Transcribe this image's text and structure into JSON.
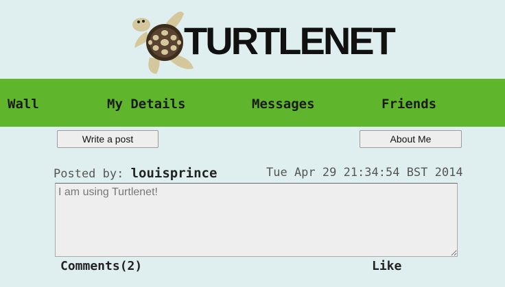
{
  "header": {
    "logo_text": "TURTLENET",
    "logo_icon": "turtle-icon"
  },
  "nav": {
    "items": [
      {
        "label": "Wall"
      },
      {
        "label": "My Details"
      },
      {
        "label": "Messages"
      },
      {
        "label": "Friends"
      }
    ]
  },
  "actions": {
    "write_post_label": "Write a post",
    "about_me_label": "About Me"
  },
  "post": {
    "posted_by_label": "Posted by:",
    "author": "louisprince",
    "timestamp": "Tue Apr 29 21:34:54 BST 2014",
    "content": "I am using Turtlenet!",
    "comments_label": "Comments(2)",
    "like_label": "Like"
  },
  "colors": {
    "background": "#dfeeee",
    "nav_bar": "#5fb52b",
    "text": "#1b1b1b"
  }
}
